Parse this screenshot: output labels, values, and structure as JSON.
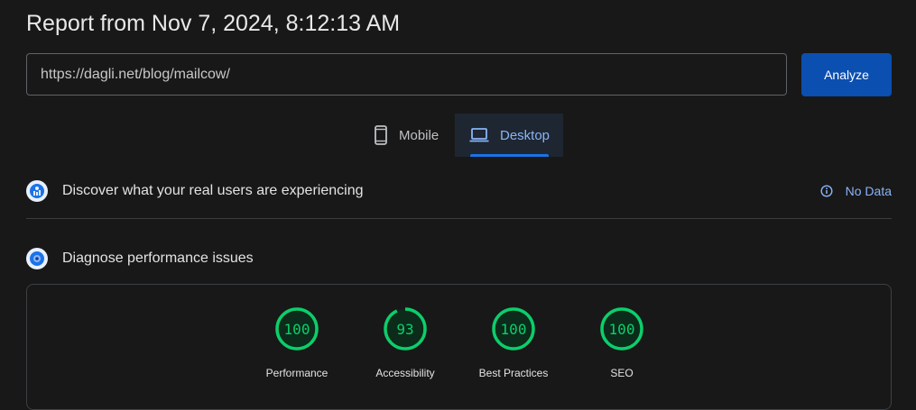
{
  "header": {
    "title": "Report from Nov 7, 2024, 8:12:13 AM"
  },
  "url_input": {
    "value": "https://dagli.net/blog/mailcow/"
  },
  "analyze_button": {
    "label": "Analyze"
  },
  "tabs": [
    {
      "label": "Mobile",
      "icon": "smartphone-icon",
      "selected": false
    },
    {
      "label": "Desktop",
      "icon": "laptop-icon",
      "selected": true
    }
  ],
  "field_data": {
    "title": "Discover what your real users are experiencing",
    "status": "No Data",
    "status_icon": "info-icon"
  },
  "lab_data": {
    "title": "Diagnose performance issues",
    "scores": [
      {
        "label": "Performance",
        "score": "100",
        "value": 100
      },
      {
        "label": "Accessibility",
        "score": "93",
        "value": 93
      },
      {
        "label": "Best Practices",
        "score": "100",
        "value": 100
      },
      {
        "label": "SEO",
        "score": "100",
        "value": 100
      }
    ]
  },
  "colors": {
    "pass": "#0cce6b",
    "accent": "#0b4fb0",
    "link": "#8ab4f8",
    "background": "#181818"
  }
}
